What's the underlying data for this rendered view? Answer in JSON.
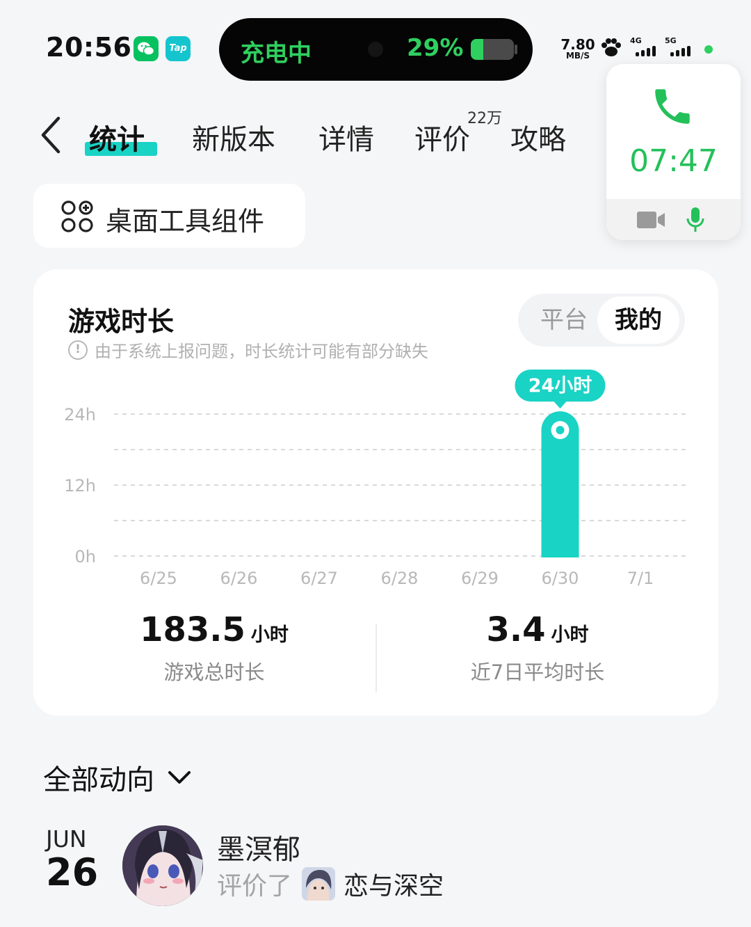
{
  "status_bar": {
    "time": "20:56",
    "apps": [
      "wechat-icon",
      "taptap-icon"
    ],
    "tap_label": "Tap",
    "charging_text": "充电中",
    "battery_percent_text": "29%",
    "battery_level": 0.29,
    "net_speed": "7.80",
    "net_speed_unit": "MB/S",
    "sim1": "4G",
    "sim2": "5G",
    "accent_green": "#2fd05f"
  },
  "call_widget": {
    "timer": "07:47",
    "icons": [
      "phone-icon",
      "video-camera-icon",
      "microphone-icon"
    ],
    "color": "#24c05a"
  },
  "nav": {
    "tabs": [
      {
        "label": "统计",
        "active": true
      },
      {
        "label": "新版本",
        "active": false
      },
      {
        "label": "详情",
        "active": false
      },
      {
        "label": "评价",
        "active": false,
        "badge": "22万"
      },
      {
        "label": "攻略",
        "active": false
      }
    ],
    "accent": "#19d3c5"
  },
  "desk_widget_button": {
    "label": "桌面工具组件",
    "icon": "widget-grid-icon"
  },
  "play_time_card": {
    "title": "游戏时长",
    "notice": "由于系统上报问题，时长统计可能有部分缺失",
    "segment": {
      "options": [
        "平台",
        "我的"
      ],
      "selected": "我的"
    },
    "stats": {
      "total_value": "183.5",
      "total_unit": "小时",
      "total_caption": "游戏总时长",
      "avg_value": "3.4",
      "avg_unit": "小时",
      "avg_caption": "近7日平均时长"
    }
  },
  "chart_data": {
    "type": "bar",
    "categories": [
      "6/25",
      "6/26",
      "6/27",
      "6/28",
      "6/29",
      "6/30",
      "7/1"
    ],
    "values": [
      0,
      0,
      0,
      0,
      0,
      24,
      0
    ],
    "y_ticks": [
      "0h",
      "12h",
      "24h"
    ],
    "ylim": [
      0,
      24
    ],
    "grid": true,
    "highlight": {
      "category": "6/30",
      "label": "24小时"
    },
    "bar_color": "#19d3c5"
  },
  "feed": {
    "filter_label": "全部动向",
    "items": [
      {
        "month": "JUN",
        "day": "26",
        "user": "墨溟郁",
        "verb": "评价了",
        "game": "恋与深空"
      }
    ]
  }
}
